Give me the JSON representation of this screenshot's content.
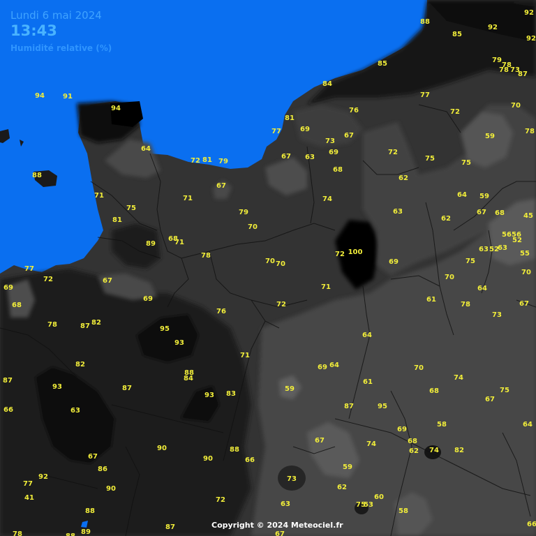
{
  "header": {
    "date": "Lundi 6 mai 2024",
    "time": "13:43",
    "parameter": "Humidité relative (%)"
  },
  "footer": {
    "copyright": "Copyright © 2024 Meteociel.fr"
  },
  "colors": {
    "sea": "#0a6ff0",
    "label": "#f2ee3a",
    "header": "#3fa3ff"
  },
  "observations": [
    "92",
    "88",
    "85",
    "92",
    "92",
    "79",
    "78",
    "73",
    "87",
    "78",
    "85",
    "84",
    "77",
    "76",
    "72",
    "70",
    "81",
    "77",
    "69",
    "73",
    "67",
    "59",
    "78",
    "94",
    "91",
    "94",
    "64",
    "72",
    "81",
    "79",
    "69",
    "63",
    "67",
    "72",
    "68",
    "75",
    "88",
    "62",
    "75",
    "71",
    "67",
    "74",
    "64",
    "59",
    "71",
    "75",
    "79",
    "63",
    "67",
    "68",
    "81",
    "70",
    "62",
    "45",
    "56",
    "56",
    "52",
    "89",
    "68",
    "71",
    "78",
    "72",
    "100",
    "63",
    "52",
    "63",
    "55",
    "69",
    "70",
    "70",
    "75",
    "70",
    "77",
    "72",
    "67",
    "69",
    "71",
    "70",
    "64",
    "68",
    "69",
    "61",
    "72",
    "67",
    "76",
    "78",
    "73",
    "78",
    "87",
    "82",
    "95",
    "93",
    "64",
    "82",
    "88",
    "84",
    "71",
    "69",
    "64",
    "70",
    "87",
    "93",
    "87",
    "93",
    "83",
    "59",
    "61",
    "74",
    "67",
    "75",
    "63",
    "87",
    "95",
    "68",
    "64",
    "66",
    "67",
    "58",
    "74",
    "69",
    "68",
    "62",
    "74",
    "82",
    "67",
    "92",
    "90",
    "88",
    "66",
    "86",
    "77",
    "90",
    "59",
    "73",
    "62",
    "90",
    "63",
    "75",
    "53",
    "60",
    "72",
    "41",
    "88",
    "58",
    "89",
    "87",
    "67",
    "66",
    "78",
    "88"
  ]
}
